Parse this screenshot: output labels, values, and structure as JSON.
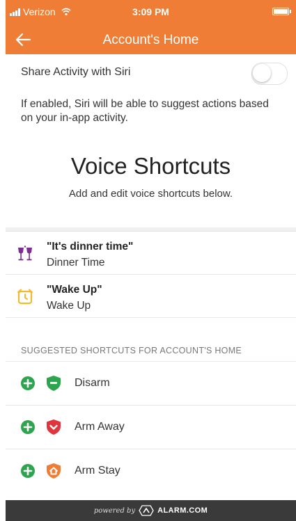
{
  "status_bar": {
    "carrier": "Verizon",
    "time": "3:09 PM"
  },
  "nav": {
    "title": "Account's Home"
  },
  "siri": {
    "label": "Share Activity with Siri",
    "enabled": false,
    "description": "If enabled, Siri will be able to suggest actions based on your in-app activity."
  },
  "voice_shortcuts": {
    "title": "Voice Shortcuts",
    "subtitle": "Add and edit voice shortcuts below.",
    "items": [
      {
        "phrase": "\"It's dinner time\"",
        "name": "Dinner Time",
        "icon": "wine-glasses-icon",
        "icon_color": "#7b2f8f"
      },
      {
        "phrase": "\"Wake Up\"",
        "name": "Wake Up",
        "icon": "alarm-clock-icon",
        "icon_color": "#f5b82e"
      }
    ]
  },
  "suggested": {
    "header": "SUGGESTED SHORTCUTS FOR ACCOUNT'S HOME",
    "items": [
      {
        "label": "Disarm",
        "icon": "shield-disarm-icon",
        "color": "#2ea44f"
      },
      {
        "label": "Arm Away",
        "icon": "shield-away-icon",
        "color": "#e0353d"
      },
      {
        "label": "Arm Stay",
        "icon": "shield-stay-icon",
        "color": "#ef7d35"
      }
    ],
    "add_color": "#2ea44f"
  },
  "footer": {
    "powered_by": "powered by",
    "brand": "ALARM.COM"
  },
  "colors": {
    "accent": "#ef7d35",
    "footer_bg": "#3a3a3a"
  }
}
